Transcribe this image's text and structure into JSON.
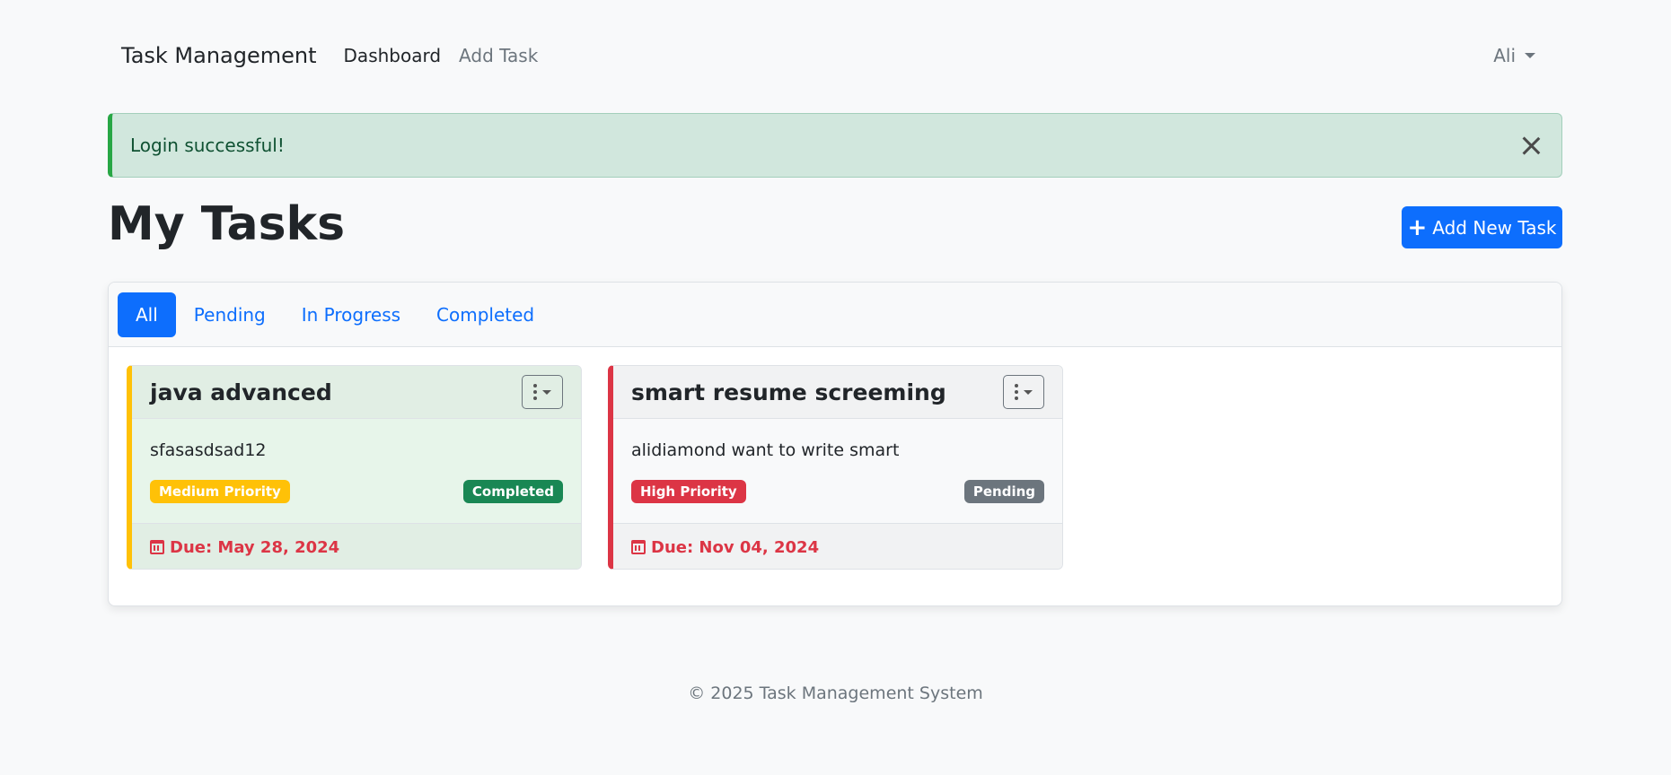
{
  "navbar": {
    "brand": "Task Management",
    "links": [
      "Dashboard",
      "Add Task"
    ],
    "user": "Ali"
  },
  "alert": {
    "message": "Login successful!"
  },
  "page": {
    "title": "My Tasks",
    "add_button": "Add New Task"
  },
  "tabs": [
    "All",
    "Pending",
    "In Progress",
    "Completed"
  ],
  "tasks": [
    {
      "title": "java advanced",
      "description": "sfasasdsad12",
      "priority": "Medium Priority",
      "status": "Completed",
      "due": "Due: May 28, 2024"
    },
    {
      "title": "smart resume screeming",
      "description": "alidiamond want to write smart",
      "priority": "High Priority",
      "status": "Pending",
      "due": "Due: Nov 04, 2024"
    }
  ],
  "footer": "© 2025 Task Management System",
  "colors": {
    "primary": "#0d6efd",
    "success": "#198754",
    "warning": "#ffc107",
    "danger": "#dc3545",
    "secondary": "#6c757d"
  }
}
